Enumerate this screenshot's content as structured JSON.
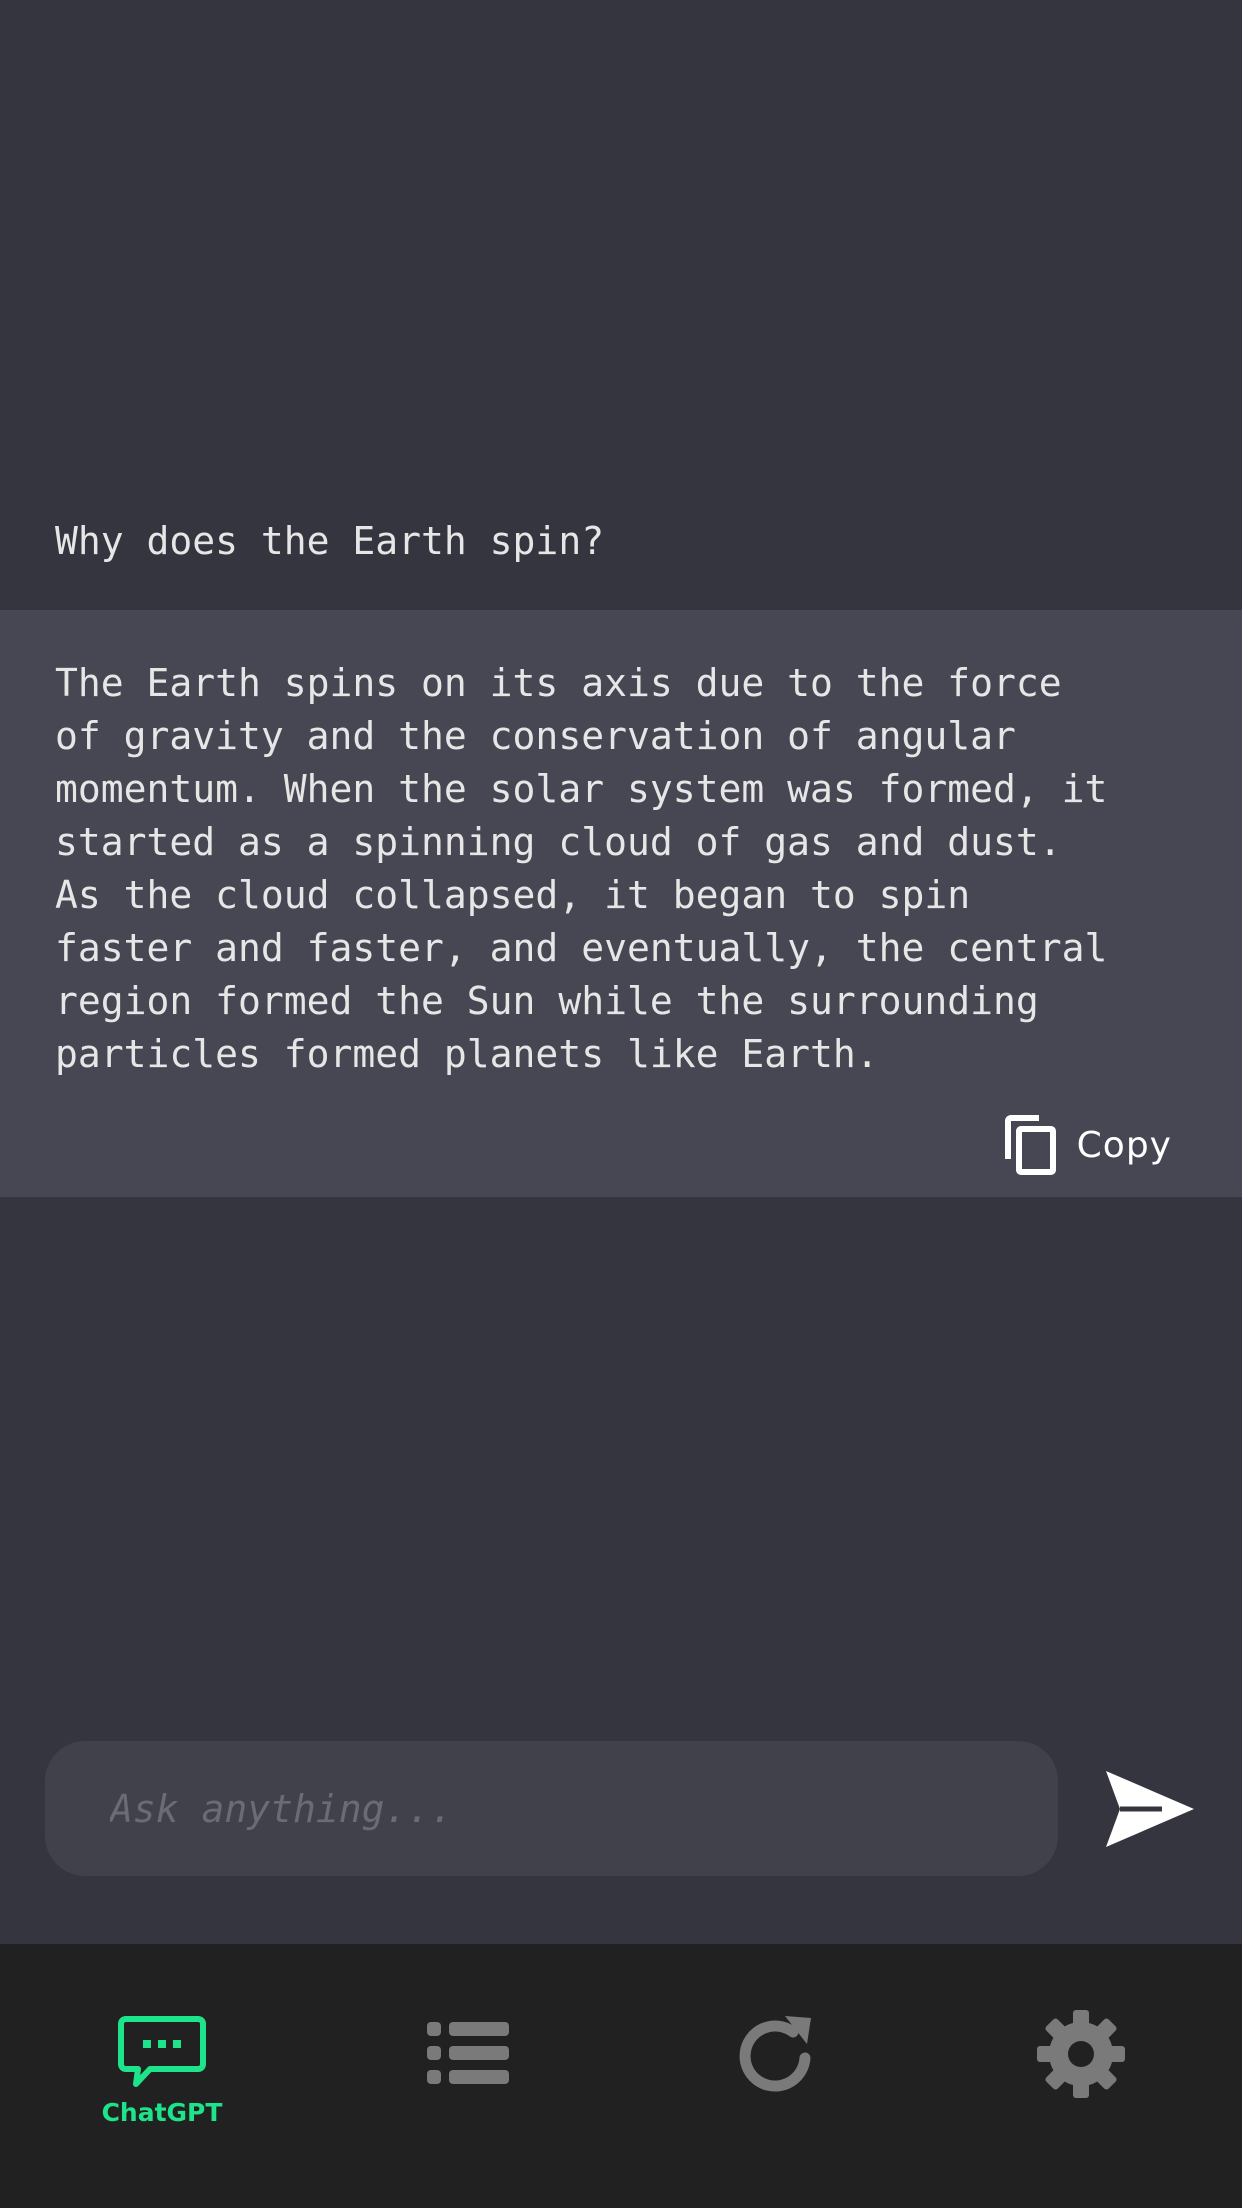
{
  "conversation": {
    "question": "Why does the Earth spin?",
    "answer": "The Earth spins on its axis due to the force\nof gravity and the conservation of angular\nmomentum. When the solar system was formed, it\nstarted as a spinning cloud of gas and dust.\nAs the cloud collapsed, it began to spin\nfaster and faster, and eventually, the central\nregion formed the Sun while the surrounding\nparticles formed planets like Earth.",
    "copy_label": "Copy",
    "copy_icon": "copy-icon"
  },
  "composer": {
    "placeholder": "Ask anything...",
    "value": "",
    "send_icon": "send-icon"
  },
  "tab_bar": {
    "tabs": [
      {
        "icon": "chat-bubble-icon",
        "label": "ChatGPT",
        "active": true
      },
      {
        "icon": "list-icon",
        "label": "",
        "active": false
      },
      {
        "icon": "refresh-icon",
        "label": "",
        "active": false
      },
      {
        "icon": "gear-icon",
        "label": "",
        "active": false
      }
    ]
  },
  "colors": {
    "background": "#35353f",
    "answer_background": "#474753",
    "input_background": "#41414c",
    "tab_bar_background": "#212121",
    "accent": "#1de38a",
    "inactive_icon": "#7a7a7a",
    "text": "#e6e6e6"
  }
}
